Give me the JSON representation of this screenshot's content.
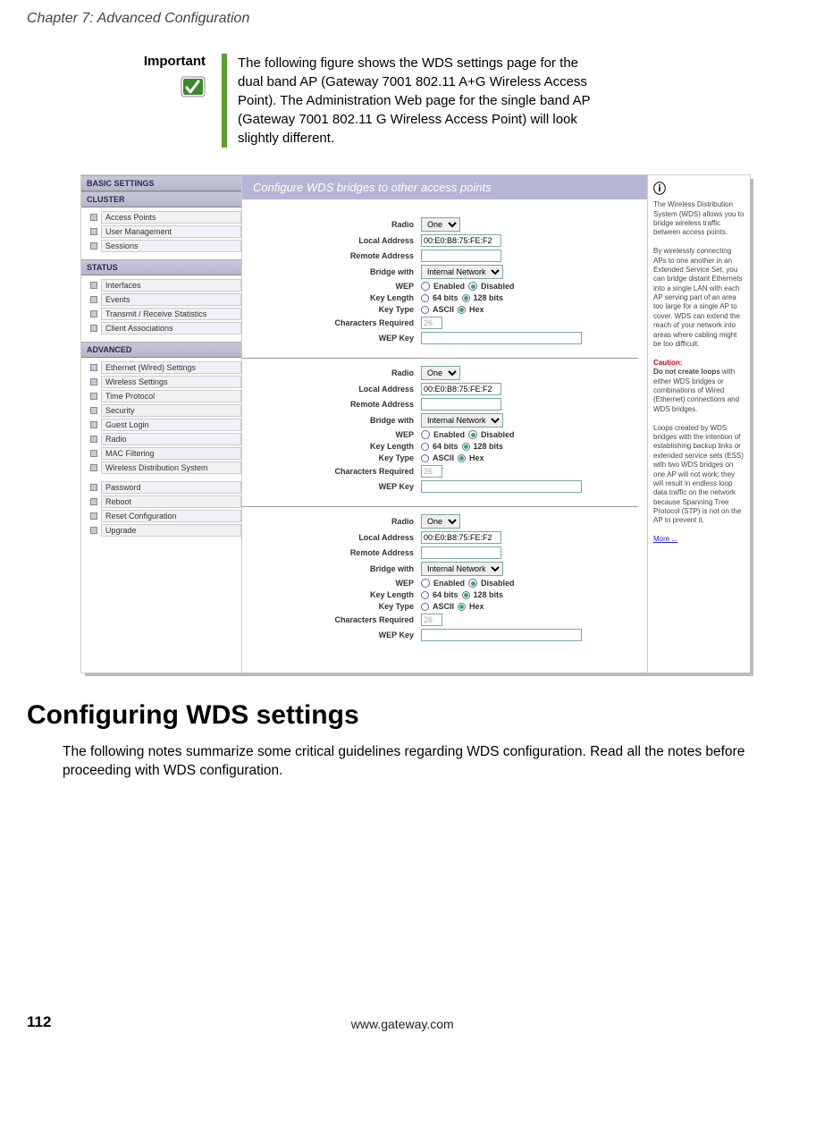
{
  "chapter": "Chapter 7: Advanced Configuration",
  "important": {
    "label": "Important",
    "text": "The following figure shows the WDS settings page for the dual band AP (Gateway 7001 802.11 A+G Wireless Access Point). The Administration Web page for the single band AP (Gateway 7001 802.11 G Wireless Access Point) will look slightly different."
  },
  "screenshot": {
    "banner": "Configure WDS bridges to other access points",
    "nav": {
      "basic": "BASIC SETTINGS",
      "cluster": {
        "hdr": "CLUSTER",
        "items": [
          "Access Points",
          "User Management",
          "Sessions"
        ]
      },
      "status": {
        "hdr": "STATUS",
        "items": [
          "Interfaces",
          "Events",
          "Transmit / Receive Statistics",
          "Client Associations"
        ]
      },
      "advanced": {
        "hdr": "ADVANCED",
        "items": [
          "Ethernet (Wired) Settings",
          "Wireless Settings",
          "Time Protocol",
          "Security",
          "Guest Login",
          "Radio",
          "MAC Filtering",
          "Wireless Distribution System"
        ]
      },
      "tail": [
        "Password",
        "Reboot",
        "Reset Configuration",
        "Upgrade"
      ]
    },
    "form_labels": {
      "radio": "Radio",
      "local": "Local Address",
      "remote": "Remote Address",
      "bridge": "Bridge with",
      "wep": "WEP",
      "keylen": "Key Length",
      "keytype": "Key Type",
      "creq": "Characters Required",
      "wepkey": "WEP Key"
    },
    "opts": {
      "radio_sel": "One",
      "bridge_sel": "Internal Network",
      "enabled": "Enabled",
      "disabled": "Disabled",
      "b64": "64 bits",
      "b128": "128 bits",
      "ascii": "ASCII",
      "hex": "Hex",
      "creq_val": "26"
    },
    "blocks": [
      {
        "local": "00:E0:B8:75:FE:F2"
      },
      {
        "local": "00:E0:B8:75:FE:F2"
      },
      {
        "local": "00:E0:B8:75:FE:F2"
      }
    ],
    "help": {
      "p1": "The Wireless Distribution System (WDS) allows you to bridge wireless traffic between access points.",
      "p2": "By wirelessly connecting APs to one another in an Extended Service Set, you can bridge distant Ethernets into a single LAN with each AP serving part of an area too large for a single AP to cover. WDS can extend the reach of your network into areas where cabling might be too difficult.",
      "caution_label": "Caution:",
      "caution1": "Do not create loops",
      "caution2": " with either WDS bridges or combinations of Wired (Ethernet) connections and WDS bridges.",
      "p3": "Loops created by WDS bridges with the intention of establishing backup links or extended service sets (ESS) with two WDS bridges on one AP will not work; they will result in endless loop data traffic on the network because Spanning Tree Protocol (STP) is not on the AP to prevent it.",
      "more": "More ..."
    }
  },
  "section_title": "Configuring WDS settings",
  "section_para": "The following notes summarize some critical guidelines regarding WDS configuration. Read all the notes before proceeding with WDS configuration.",
  "footer": {
    "page": "112",
    "url": "www.gateway.com"
  }
}
